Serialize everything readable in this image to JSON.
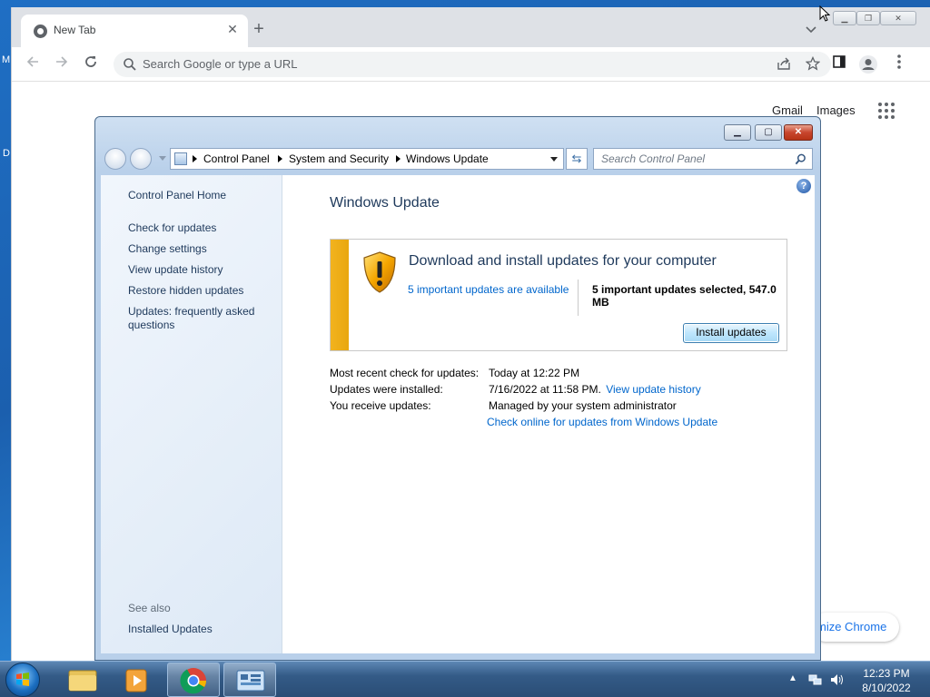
{
  "desktop": {
    "left_labels": [
      "M",
      "D"
    ]
  },
  "chrome": {
    "tab_title": "New Tab",
    "tab_close": "✕",
    "new_tab": "+",
    "omnibox_placeholder": "Search Google or type a URL",
    "gmail": "Gmail",
    "images": "Images",
    "customize": "mize Chrome"
  },
  "control_panel": {
    "breadcrumbs": [
      "Control Panel",
      "System and Security",
      "Windows Update"
    ],
    "search_placeholder": "Search Control Panel",
    "sidebar": {
      "home": "Control Panel Home",
      "links": [
        "Check for updates",
        "Change settings",
        "View update history",
        "Restore hidden updates",
        "Updates: frequently asked questions"
      ],
      "see_also": "See also",
      "installed_updates": "Installed Updates"
    },
    "title": "Windows Update",
    "panel": {
      "heading": "Download and install updates for your computer",
      "available_link": "5 important updates are available",
      "selected": "5 important updates selected, 547.0 MB",
      "install_button": "Install updates"
    },
    "info": {
      "recent_check_label": "Most recent check for updates:",
      "recent_check_value": "Today at 12:22 PM",
      "installed_label": "Updates were installed:",
      "installed_value": "7/16/2022 at 11:58 PM.",
      "history_link": "View update history",
      "receive_label": "You receive updates:",
      "receive_value": "Managed by your system administrator",
      "check_online_link": "Check online for updates from Windows Update"
    }
  },
  "taskbar": {
    "time": "12:23 PM",
    "date": "8/10/2022"
  },
  "icons": {
    "search": "search-icon",
    "star": "star-icon",
    "share": "share-icon",
    "profile": "profile-icon",
    "shield_warning": "shield-warning-icon"
  },
  "colors": {
    "link": "#0066cc",
    "title_text": "#1e395b",
    "warning_stripe": "#f2b31f"
  }
}
